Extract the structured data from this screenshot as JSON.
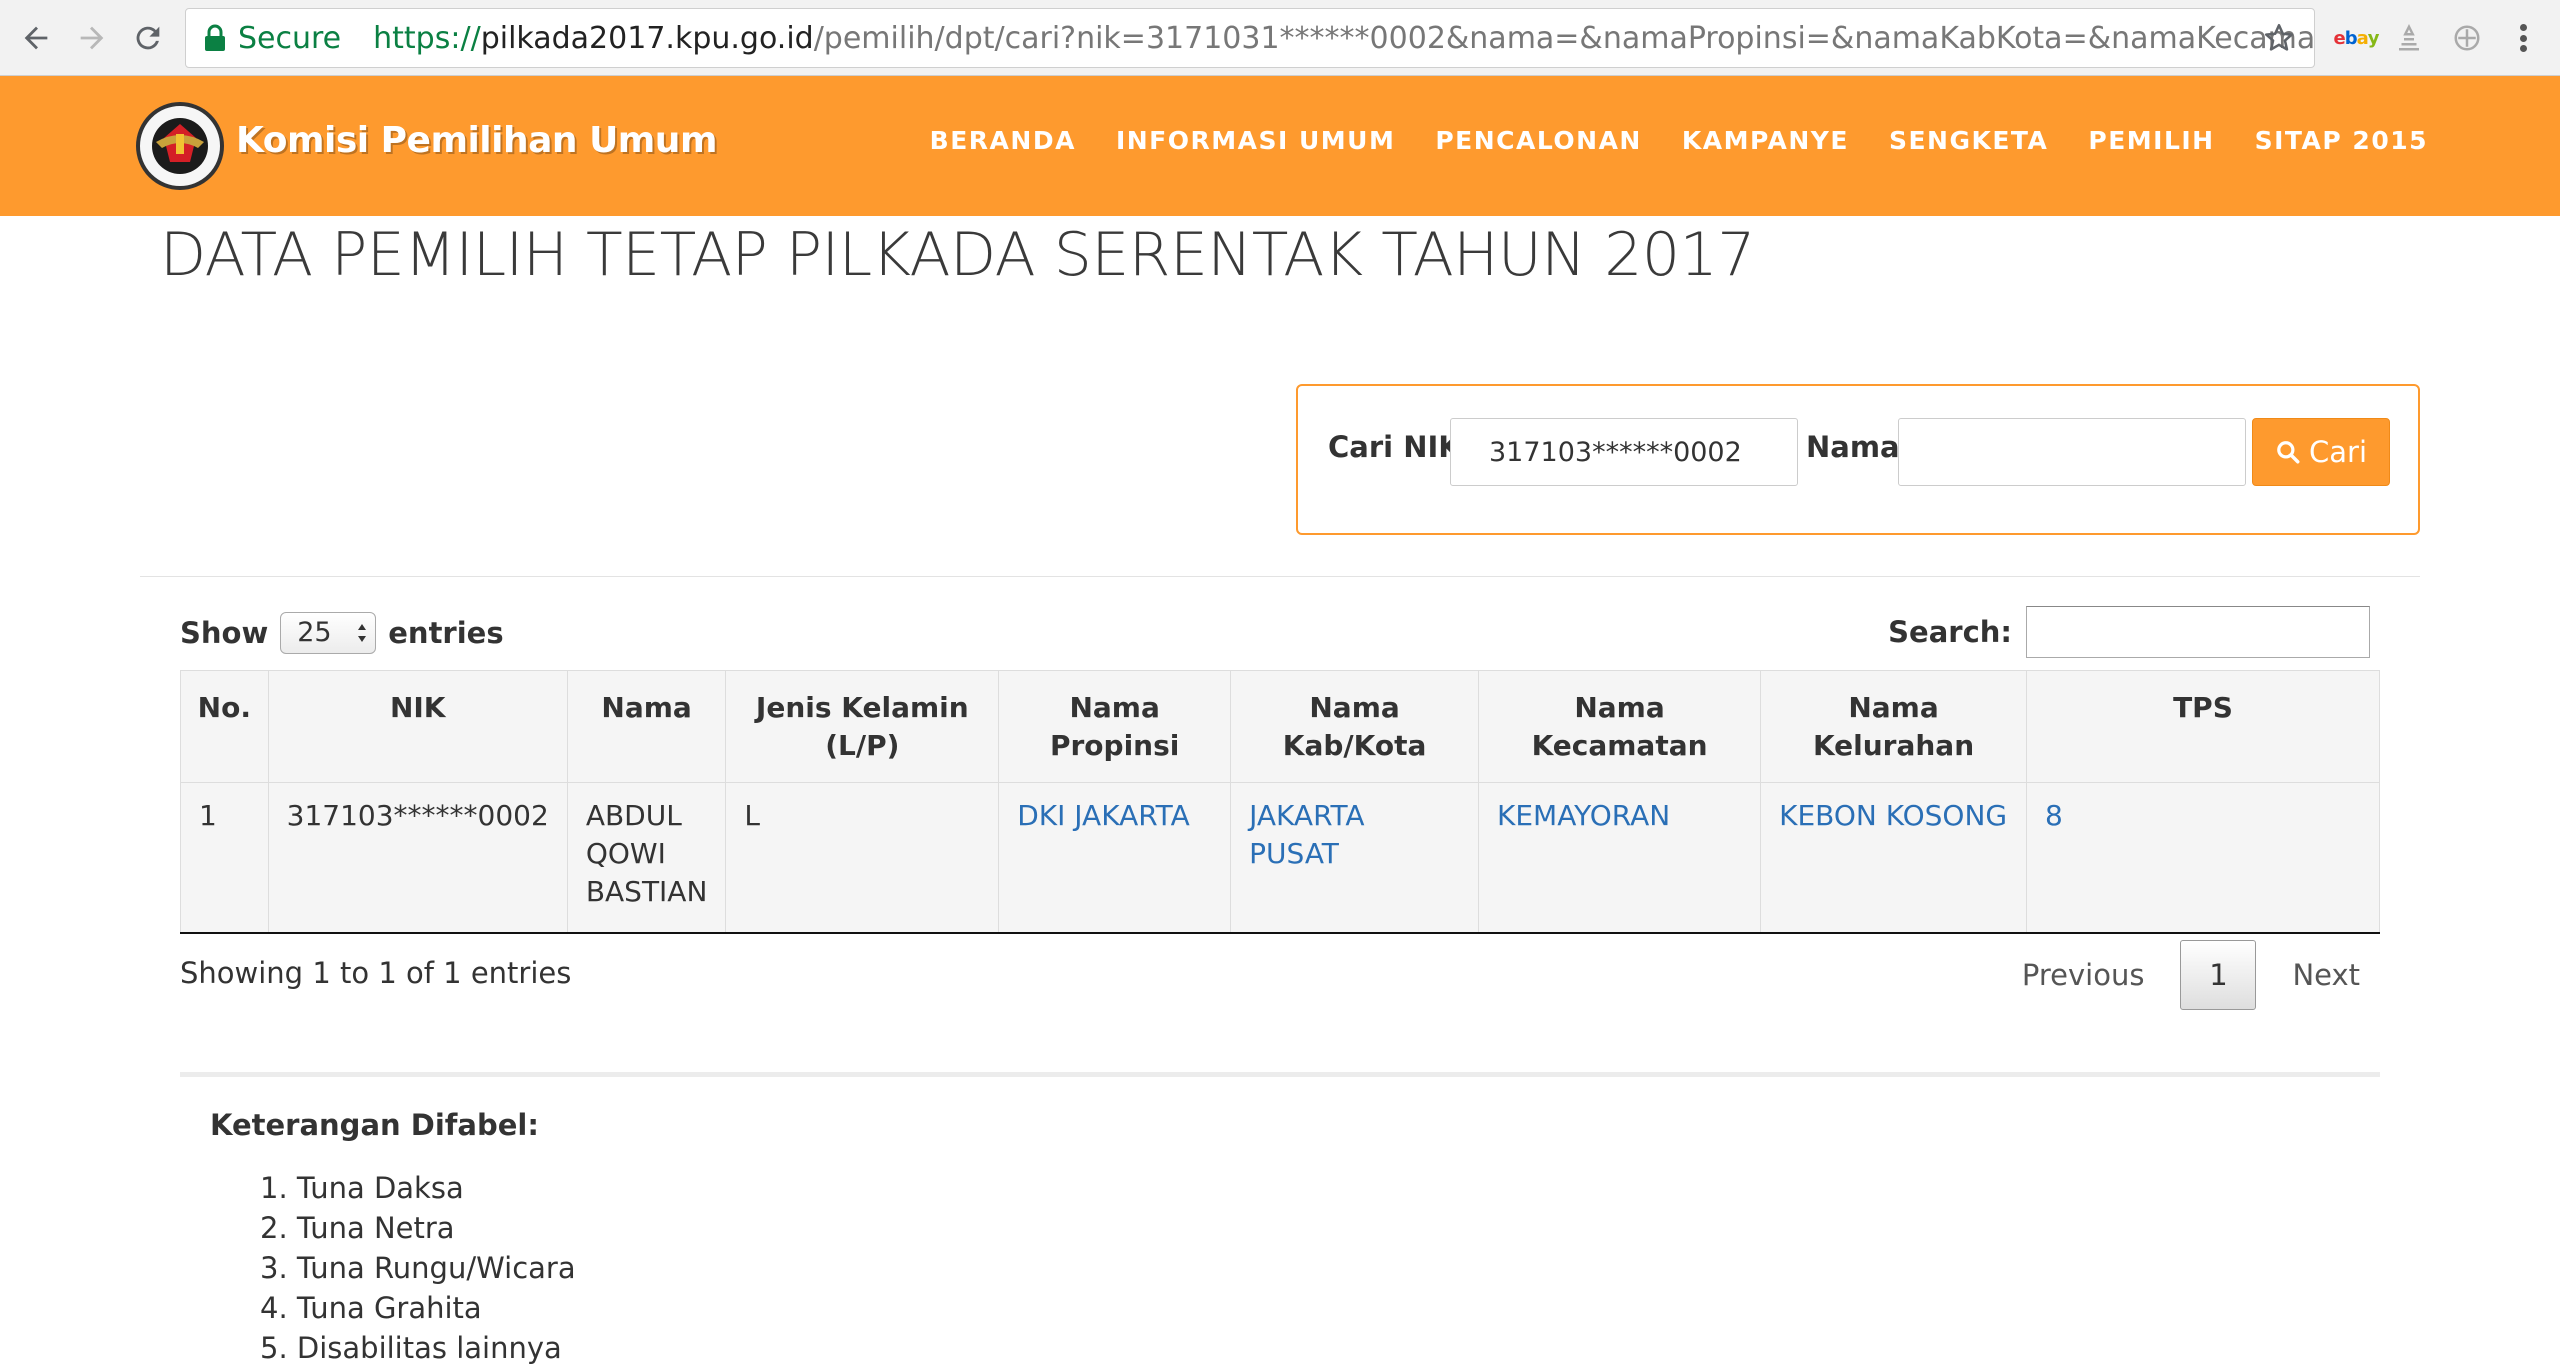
{
  "browser": {
    "secure_label": "Secure",
    "url_scheme": "https://",
    "url_host": "pilkada2017.kpu.go.id",
    "url_path": "/pemilih/dpt/cari?nik=3171031******0002&nama=&namaPropinsi=&namaKabKota=&namaKecamatan=&...",
    "icons": [
      "back-icon",
      "forward-icon",
      "reload-icon",
      "lock-icon",
      "star-icon",
      "ebay-extension-icon",
      "menu-icon"
    ],
    "extension_ebay": "ebay"
  },
  "header": {
    "site_name": "Komisi Pemilihan Umum",
    "logo_text": "KOMISI PEMILIHAN UMUM",
    "nav": [
      "BERANDA",
      "INFORMASI UMUM",
      "PENCALONAN",
      "KAMPANYE",
      "SENGKETA",
      "PEMILIH",
      "SITAP 2015"
    ],
    "brand_color": "#fe9a2e"
  },
  "page": {
    "title": "DATA PEMILIH TETAP PILKADA SERENTAK TAHUN 2017"
  },
  "search_form": {
    "nik_label": "Cari NIK",
    "nik_value": "317103******0002",
    "nama_label": "Nama",
    "nama_value": "",
    "button_label": "Cari"
  },
  "datatable": {
    "show_label": "Show",
    "entries_label": "entries",
    "page_size": "25",
    "search_label": "Search:",
    "search_value": "",
    "columns": [
      "No.",
      "NIK",
      "Nama",
      "Jenis Kelamin (L/P)",
      "Nama Propinsi",
      "Nama Kab/Kota",
      "Nama Kecamatan",
      "Nama Kelurahan",
      "TPS"
    ],
    "rows": [
      {
        "no": "1",
        "nik": "317103******0002",
        "nama": "ABDUL QOWI BASTIAN",
        "jenis_kelamin": "L",
        "propinsi": "DKI JAKARTA",
        "kabkota": "JAKARTA PUSAT",
        "kecamatan": "KEMAYORAN",
        "kelurahan": "KEBON KOSONG",
        "tps": "8"
      }
    ],
    "info": "Showing 1 to 1 of 1 entries",
    "pagination": {
      "previous": "Previous",
      "current": "1",
      "next": "Next"
    },
    "link_color": "#2a6fb6"
  },
  "keterangan": {
    "title": "Keterangan Difabel:",
    "items": [
      "1. Tuna Daksa",
      "2. Tuna Netra",
      "3. Tuna Rungu/Wicara",
      "4. Tuna Grahita",
      "5. Disabilitas lainnya"
    ]
  }
}
